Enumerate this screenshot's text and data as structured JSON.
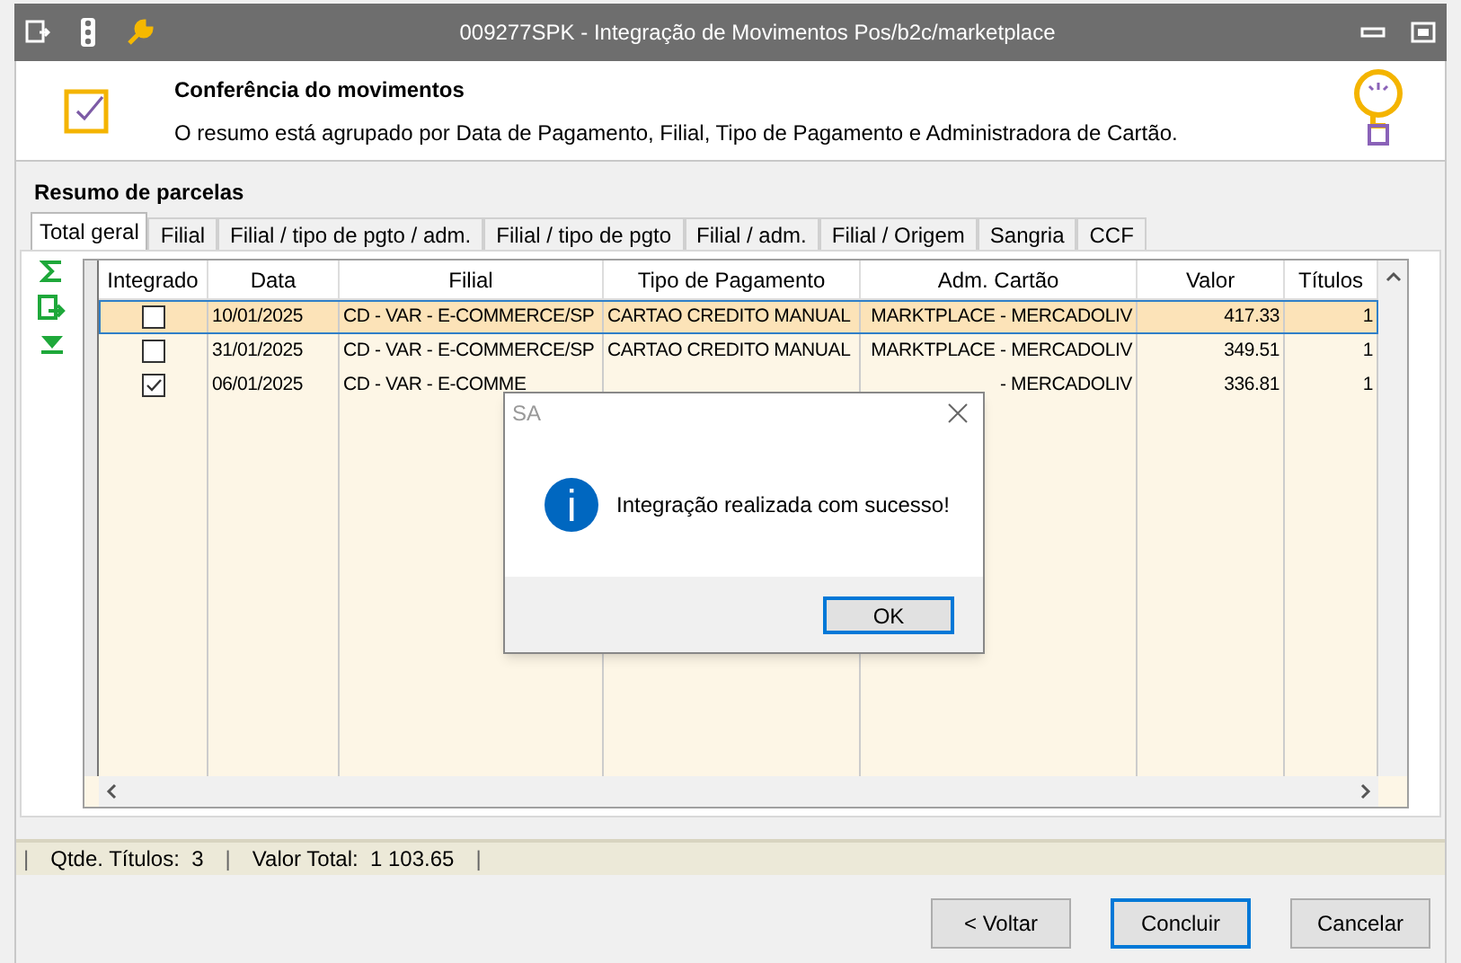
{
  "window": {
    "title": "009277SPK - Integração de Movimentos Pos/b2c/marketplace"
  },
  "header": {
    "title": "Conferência do movimentos",
    "description": "O resumo está agrupado por Data de Pagamento, Filial, Tipo de Pagamento e Administradora de Cartão."
  },
  "section_title": "Resumo de parcelas",
  "tabs": [
    {
      "label": "Total geral",
      "selected": true
    },
    {
      "label": "Filial",
      "selected": false
    },
    {
      "label": "Filial / tipo de pgto / adm.",
      "selected": false
    },
    {
      "label": "Filial / tipo de pgto",
      "selected": false
    },
    {
      "label": "Filial / adm.",
      "selected": false
    },
    {
      "label": "Filial / Origem",
      "selected": false
    },
    {
      "label": "Sangria",
      "selected": false
    },
    {
      "label": "CCF",
      "selected": false
    }
  ],
  "table": {
    "columns": [
      "Integrado",
      "Data",
      "Filial",
      "Tipo de Pagamento",
      "Adm. Cartão",
      "Valor",
      "Títulos"
    ],
    "rows": [
      {
        "selected": true,
        "checked": false,
        "data": "10/01/2025",
        "filial": "CD - VAR - E-COMMERCE/SP",
        "tipo": "CARTAO CREDITO MANUAL",
        "adm": "MARKTPLACE - MERCADOLIV",
        "valor": "417.33",
        "titulos": "1"
      },
      {
        "selected": false,
        "checked": false,
        "data": "31/01/2025",
        "filial": "CD - VAR - E-COMMERCE/SP",
        "tipo": "CARTAO CREDITO MANUAL",
        "adm": "MARKTPLACE - MERCADOLIV",
        "valor": "349.51",
        "titulos": "1"
      },
      {
        "selected": false,
        "checked": true,
        "data": "06/01/2025",
        "filial": "CD - VAR - E-COMME",
        "adm": "- MERCADOLIV",
        "valor": "336.81",
        "titulos": "1"
      }
    ]
  },
  "status_bar": {
    "items": [
      "|",
      "Qtde. Títulos:  3",
      "|",
      "Valor Total:  1 103.65",
      "|"
    ]
  },
  "buttons": [
    {
      "label": "< Voltar",
      "default": false
    },
    {
      "label": "Concluir",
      "default": true
    },
    {
      "label": "Cancelar",
      "default": false
    }
  ],
  "dialog": {
    "title": "SA",
    "message": "Integração realizada com sucesso!",
    "button": "OK"
  }
}
